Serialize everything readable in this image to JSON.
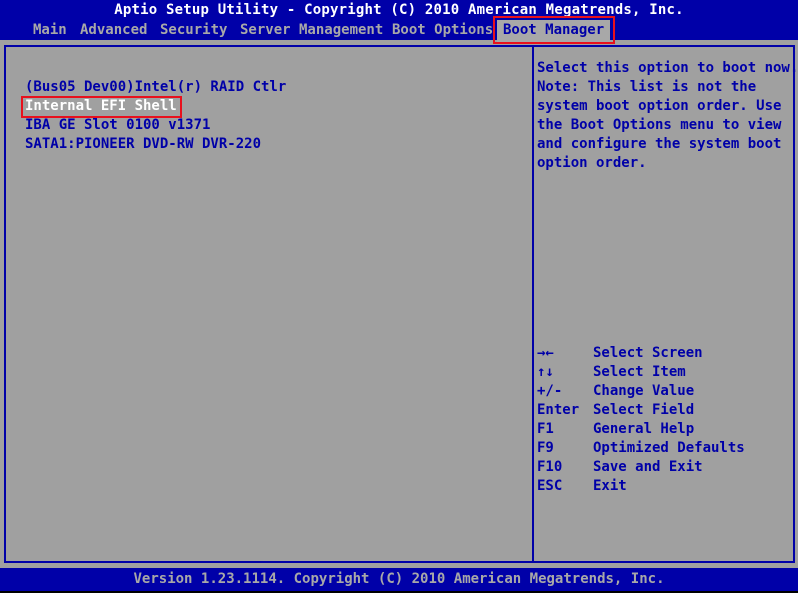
{
  "title": "Aptio Setup Utility - Copyright (C) 2010 American Megatrends, Inc.",
  "tabs": [
    {
      "label": "Main",
      "active": false
    },
    {
      "label": "Advanced",
      "active": false
    },
    {
      "label": "Security",
      "active": false
    },
    {
      "label": "Server Management",
      "active": false
    },
    {
      "label": "Boot Options",
      "active": false
    },
    {
      "label": "Boot Manager",
      "active": true
    }
  ],
  "boot_items": [
    {
      "label": "(Bus05 Dev00)Intel(r) RAID Ctlr",
      "selected": false
    },
    {
      "label": "Internal EFI Shell",
      "selected": true
    },
    {
      "label": "IBA GE Slot 0100 v1371",
      "selected": false
    },
    {
      "label": "SATA1:PIONEER DVD-RW  DVR-220",
      "selected": false
    }
  ],
  "help_text": [
    "Select this option to boot now.",
    "Note: This list is not the",
    "system boot option order. Use",
    "the Boot Options menu to view",
    "and configure the system boot",
    "option order."
  ],
  "key_legend": [
    {
      "key": "→←",
      "desc": "Select Screen"
    },
    {
      "key": "↑↓",
      "desc": "Select Item"
    },
    {
      "key": "+/-",
      "desc": "Change Value"
    },
    {
      "key": "Enter",
      "desc": "Select Field"
    },
    {
      "key": "F1",
      "desc": "General Help"
    },
    {
      "key": "F9",
      "desc": "Optimized Defaults"
    },
    {
      "key": "F10",
      "desc": "Save and Exit"
    },
    {
      "key": "ESC",
      "desc": "Exit"
    }
  ],
  "footer": "Version 1.23.1114. Copyright (C) 2010 American Megatrends, Inc.",
  "colors": {
    "bios_blue": "#0000a8",
    "bios_gray": "#a0a0a0",
    "highlight_red": "#e8101c",
    "selected_text": "#ffffff"
  }
}
